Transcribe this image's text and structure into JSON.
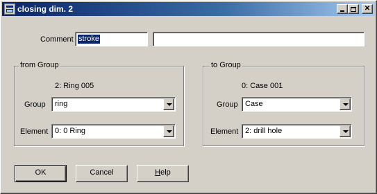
{
  "window": {
    "title": "closing dim. 2"
  },
  "comment": {
    "label": "Comment",
    "short_value": "stroke",
    "long_value": ""
  },
  "from_group": {
    "legend": "from Group",
    "info": "2: Ring 005",
    "group_label": "Group",
    "group_value": "ring",
    "element_label": "Element",
    "element_value": "0: 0 Ring"
  },
  "to_group": {
    "legend": "to Group",
    "info": "0: Case 001",
    "group_label": "Group",
    "group_value": "Case",
    "element_label": "Element",
    "element_value": "2: drill hole"
  },
  "buttons": {
    "ok": "OK",
    "cancel": "Cancel",
    "help_prefix": "H",
    "help_rest": "elp"
  }
}
